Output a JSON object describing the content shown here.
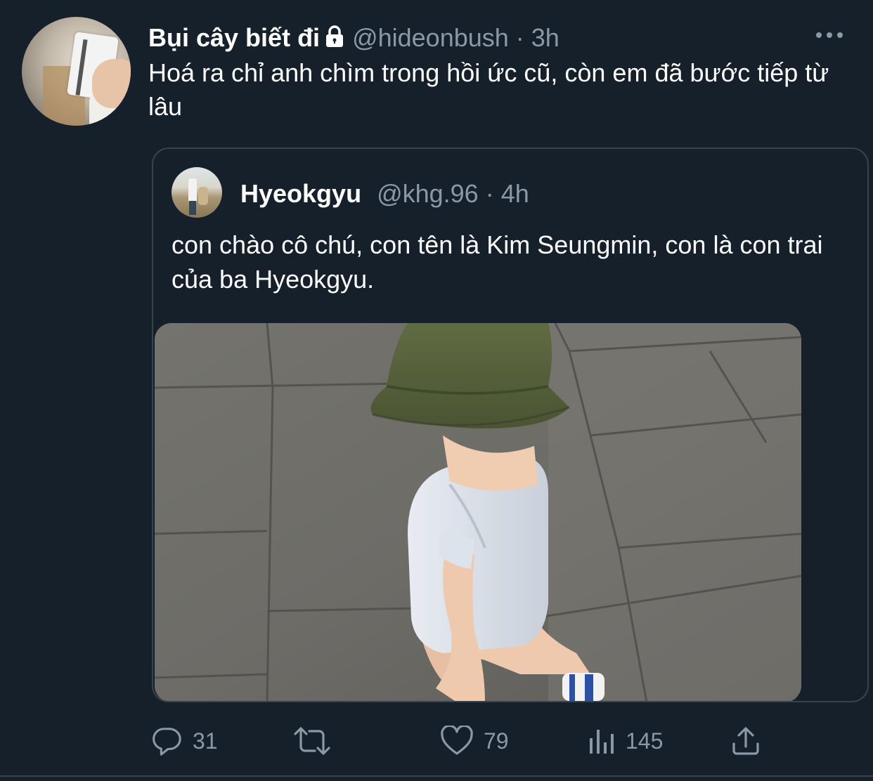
{
  "tweet": {
    "display_name": "Bụi cây biết đi",
    "handle": "@hideonbush",
    "separator": "·",
    "time": "3h",
    "protected_icon": "lock-icon",
    "text": "Hoá ra chỉ anh chìm trong hồi ức cũ, còn em đã bước tiếp từ lâu"
  },
  "quote": {
    "display_name": "Hyeokgyu",
    "handle": "@khg.96",
    "separator": "·",
    "time": "4h",
    "text": "con chào cô chú, con tên là Kim Seungmin, con là con trai của ba Hyeokgyu."
  },
  "actions": {
    "reply_count": "31",
    "retweet_count": "",
    "like_count": "79",
    "views_count": "145"
  },
  "colors": {
    "background": "#15202b",
    "secondary_text": "#8b98a5",
    "border": "#38444d"
  }
}
